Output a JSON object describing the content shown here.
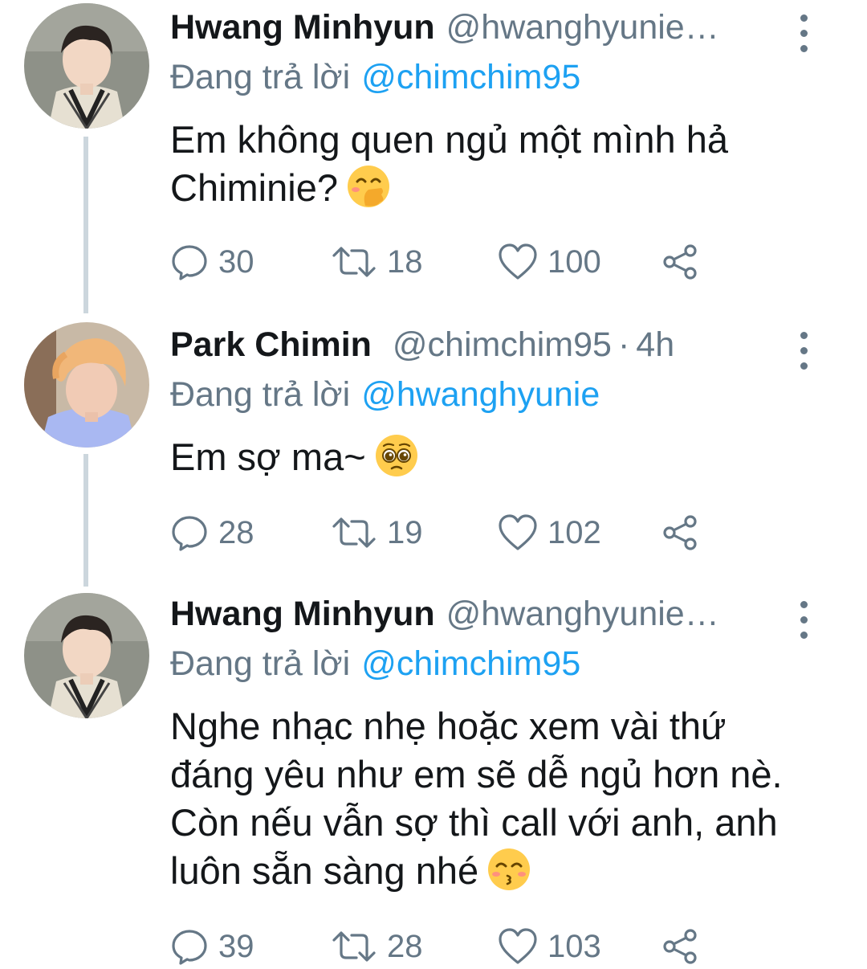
{
  "tweets": [
    {
      "name": "Hwang Minhyun",
      "handle": "@hwanghyunie…",
      "time": "",
      "replying_label": "Đang trả lời",
      "replying_to": "@chimchim95",
      "text": "Em không quen ngủ một mình hả Chiminie?",
      "emoji": "face-with-hand-over-mouth",
      "replies": "30",
      "retweets": "18",
      "likes": "100"
    },
    {
      "name": "Park Chimin",
      "handle": "@chimchim95",
      "separator": "·",
      "time": "4h",
      "replying_label": "Đang trả lời",
      "replying_to": "@hwanghyunie",
      "text": "Em sợ ma~",
      "emoji": "pleading-face",
      "replies": "28",
      "retweets": "19",
      "likes": "102"
    },
    {
      "name": "Hwang Minhyun",
      "handle": "@hwanghyunie…",
      "time": "",
      "replying_label": "Đang trả lời",
      "replying_to": "@chimchim95",
      "text": "Nghe nhạc nhẹ hoặc xem vài thứ đáng yêu như em sẽ dễ ngủ hơn nè. Còn nếu vẫn sợ thì call với anh, anh luôn sẵn sàng nhé",
      "emoji": "kissing-face-with-smiling-eyes",
      "replies": "39",
      "retweets": "28",
      "likes": "103"
    }
  ],
  "colors": {
    "secondary_text": "#657786",
    "link": "#1da1f2",
    "thread_line": "#ccd6dd"
  },
  "icons": [
    "reply-icon",
    "retweet-icon",
    "like-icon",
    "share-icon",
    "more-options-icon"
  ]
}
